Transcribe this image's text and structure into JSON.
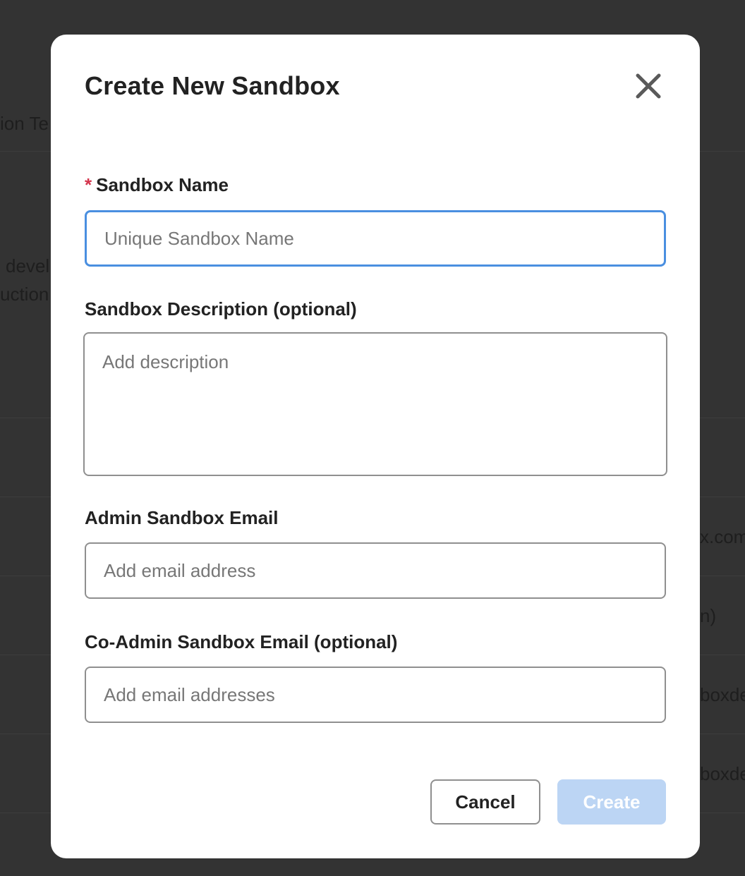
{
  "background": {
    "left_fragments": [
      "ion Te",
      "devel",
      "uction"
    ],
    "right_fragments": [
      "x.com",
      "n)",
      "boxde",
      "boxde"
    ]
  },
  "modal": {
    "title": "Create New Sandbox",
    "close_icon": "close-icon",
    "sandbox_name": {
      "required_marker": "*",
      "label": "Sandbox Name",
      "value": "",
      "placeholder": "Unique Sandbox Name"
    },
    "sandbox_description": {
      "label": "Sandbox Description (optional)",
      "value": "",
      "placeholder": "Add description"
    },
    "admin_email": {
      "label": "Admin Sandbox Email",
      "value": "",
      "placeholder": "Add email address"
    },
    "co_admin_email": {
      "label": "Co-Admin Sandbox Email (optional)",
      "value": "",
      "placeholder": "Add email addresses"
    },
    "buttons": {
      "cancel": "Cancel",
      "create": "Create"
    }
  },
  "colors": {
    "required": "#d4354d",
    "focus_border": "#4a8fe0",
    "create_disabled": "#bcd5f4",
    "overlay": "#333333"
  }
}
